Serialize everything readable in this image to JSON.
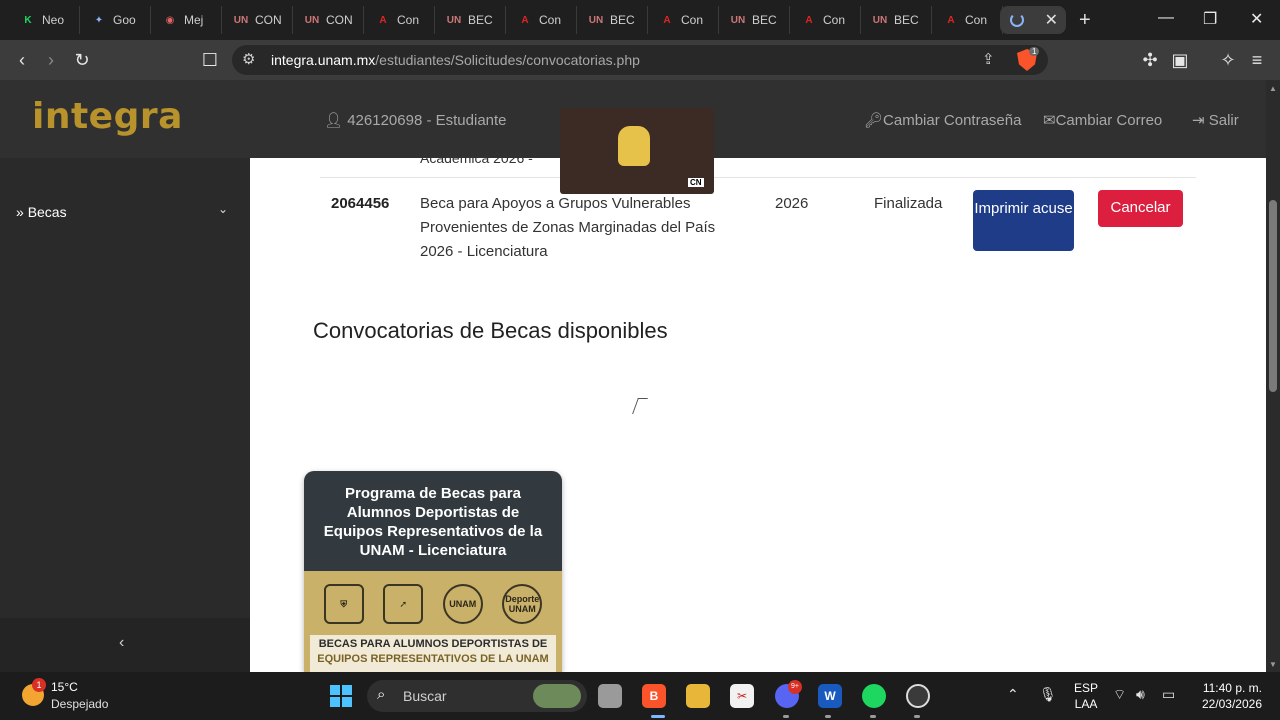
{
  "browser": {
    "tabs": [
      {
        "label": "Neo",
        "icon": "k-icon",
        "color": "#1ed760",
        "glyph": "K"
      },
      {
        "label": "Goo",
        "icon": "gemini-icon",
        "color": "#8ab4f8",
        "glyph": "✦"
      },
      {
        "label": "Mej",
        "icon": "record-icon",
        "color": "#e36262",
        "glyph": "◉"
      },
      {
        "label": "CON",
        "icon": "unam-icon",
        "color": "#c77",
        "glyph": "UN"
      },
      {
        "label": "CON",
        "icon": "unam-icon",
        "color": "#c77",
        "glyph": "UN"
      },
      {
        "label": "Con",
        "icon": "pdf-icon",
        "color": "#e02424",
        "glyph": "A"
      },
      {
        "label": "BEC",
        "icon": "unam-icon",
        "color": "#c77",
        "glyph": "UN"
      },
      {
        "label": "Con",
        "icon": "pdf-icon",
        "color": "#e02424",
        "glyph": "A"
      },
      {
        "label": "BEC",
        "icon": "unam-icon",
        "color": "#c77",
        "glyph": "UN"
      },
      {
        "label": "Con",
        "icon": "pdf-icon",
        "color": "#e02424",
        "glyph": "A"
      },
      {
        "label": "BEC",
        "icon": "unam-icon",
        "color": "#c77",
        "glyph": "UN"
      },
      {
        "label": "Con",
        "icon": "pdf-icon",
        "color": "#e02424",
        "glyph": "A"
      },
      {
        "label": "BEC",
        "icon": "unam-icon",
        "color": "#c77",
        "glyph": "UN"
      },
      {
        "label": "Con",
        "icon": "pdf-icon",
        "color": "#e02424",
        "glyph": "A"
      }
    ],
    "active_tab_close": "✕",
    "new_tab": "+",
    "window_controls": {
      "minimize": "—",
      "restore": "❐",
      "close": "✕"
    },
    "url_host": "integra.unam.mx",
    "url_path": "/estudiantes/Solicitudes/convocatorias.php",
    "shield_count": "1"
  },
  "site": {
    "logo": "integra",
    "user": "426120698 - Estudiante",
    "nav": {
      "change_password": "Cambiar Contraseña",
      "change_email": "Cambiar Correo",
      "logout": "Salir"
    },
    "sidebar": {
      "item": "Becas",
      "collapse": "‹"
    }
  },
  "content": {
    "partial_row_text": "Académica 2026 -",
    "application": {
      "folio": "2064456",
      "description": "Beca para Apoyos a Grupos Vulnerables Provenientes de Zonas Marginadas del País 2026 - Licenciatura",
      "year": "2026",
      "status": "Finalizada",
      "print_button": "Imprimir acuse",
      "cancel_button": "Cancelar"
    },
    "section_title": "Convocatorias de Becas disponibles",
    "card": {
      "title": "Programa de Becas para Alumnos Deportistas de Equipos Representativos de la UNAM - Licenciatura",
      "logo_text": "UNAM",
      "logo_text_2": "Deporte UNAM",
      "banner_line1": "BECAS PARA ALUMNOS DEPORTISTAS DE",
      "banner_line2": "EQUIPOS REPRESENTATIVOS DE LA UNAM"
    },
    "video_logo": "CN"
  },
  "taskbar": {
    "weather_badge": "1",
    "temperature": "15°C",
    "weather": "Despejado",
    "search": "Buscar",
    "notification_badge": "9+",
    "language_1": "ESP",
    "language_2": "LAA",
    "time": "11:40 p. m.",
    "date": "22/03/2026"
  }
}
